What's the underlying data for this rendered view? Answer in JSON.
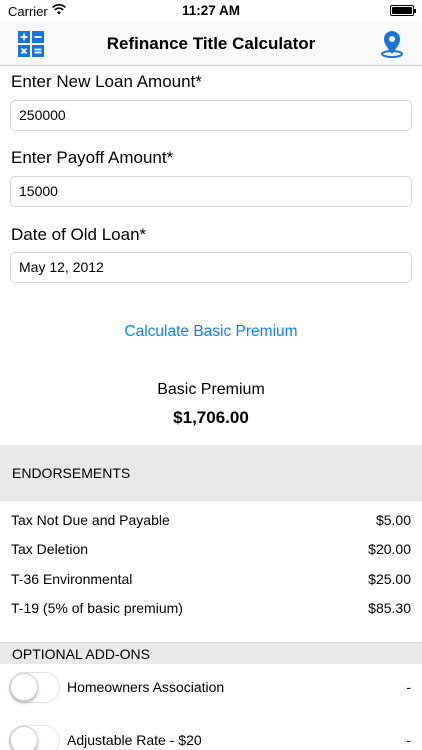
{
  "status_bar": {
    "carrier": "Carrier",
    "time": "11:27 AM"
  },
  "nav": {
    "title": "Refinance Title Calculator"
  },
  "form": {
    "loan_amount_label": "Enter New Loan Amount*",
    "loan_amount_value": "250000",
    "payoff_label": "Enter Payoff Amount*",
    "payoff_value": "15000",
    "date_label": "Date of Old Loan*",
    "date_value": "May 12, 2012"
  },
  "calculate_label": "Calculate Basic Premium",
  "premium": {
    "label": "Basic Premium",
    "value": "$1,706.00"
  },
  "endorsements": {
    "header": "ENDORSEMENTS",
    "items": [
      {
        "name": "Tax Not Due and Payable",
        "price": "$5.00"
      },
      {
        "name": "Tax Deletion",
        "price": "$20.00"
      },
      {
        "name": "T-36 Environmental",
        "price": "$25.00"
      },
      {
        "name": "T-19 (5% of basic premium)",
        "price": "$85.30"
      }
    ]
  },
  "addons": {
    "header": "OPTIONAL ADD-ONS",
    "items": [
      {
        "name": "Homeowners Association",
        "price": "-",
        "enabled": false
      },
      {
        "name": "Adjustable Rate - $20",
        "price": "-",
        "enabled": false
      }
    ]
  },
  "colors": {
    "accent": "#147efb",
    "section_bg": "#e9e9e9"
  },
  "icons": {
    "left_nav": "calculator-icon",
    "right_nav": "map-pin-icon",
    "wifi": "wifi-icon",
    "battery": "battery-icon"
  }
}
